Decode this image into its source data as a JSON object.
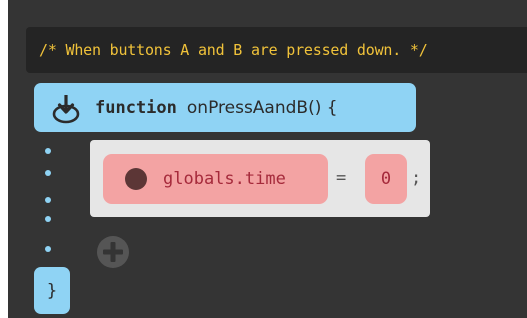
{
  "comment": {
    "text": "/* When buttons A and B are pressed down. */"
  },
  "function_block": {
    "icon": "download-arrow-circle-icon",
    "keyword": "function",
    "signature": "onPressAandB() {",
    "closing": "}"
  },
  "statement": {
    "variable_icon": "variable-dot-icon",
    "variable": "globals.time",
    "operator": "=",
    "value": "0",
    "terminator": ";"
  },
  "add_button": {
    "icon": "plus-circle-icon"
  },
  "colors": {
    "canvas_background": "#343434",
    "comment_background": "#242424",
    "comment_text": "#f0c23a",
    "function_accent": "#8fd3f4",
    "statement_card": "#e6e6e6",
    "pill": "#f3a3a3",
    "pill_text": "#a52a3b",
    "add_icon": "#555555"
  }
}
